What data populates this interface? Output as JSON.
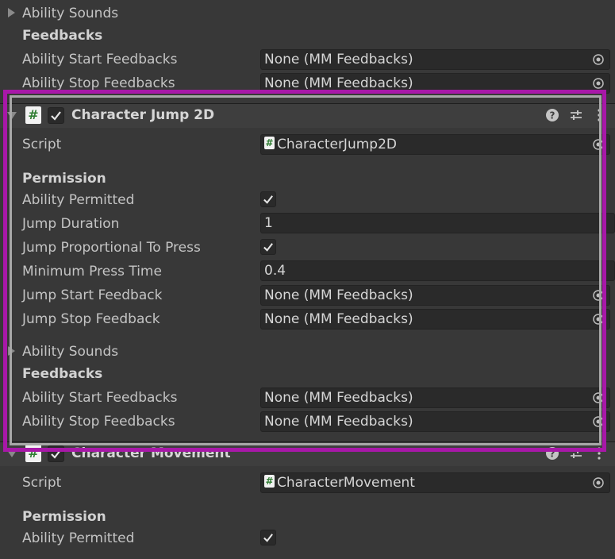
{
  "top_section": {
    "ability_sounds": "Ability Sounds",
    "feedbacks_heading": "Feedbacks",
    "start_label": "Ability Start Feedbacks",
    "start_value": "None (MM Feedbacks)",
    "stop_label": "Ability Stop Feedbacks",
    "stop_value": "None (MM Feedbacks)"
  },
  "jump_component": {
    "title": "Character Jump 2D",
    "script_label": "Script",
    "script_value": "CharacterJump2D",
    "permission_heading": "Permission",
    "ability_permitted_label": "Ability Permitted",
    "ability_permitted": true,
    "jump_duration_label": "Jump Duration",
    "jump_duration_value": "1",
    "jump_proportional_label": "Jump Proportional To Press",
    "jump_proportional": true,
    "min_press_label": "Minimum Press Time",
    "min_press_value": "0.4",
    "jump_start_label": "Jump Start Feedback",
    "jump_start_value": "None (MM Feedbacks)",
    "jump_stop_label": "Jump Stop Feedback",
    "jump_stop_value": "None (MM Feedbacks)",
    "ability_sounds": "Ability Sounds",
    "feedbacks_heading": "Feedbacks",
    "start_label": "Ability Start Feedbacks",
    "start_value": "None (MM Feedbacks)",
    "stop_label": "Ability Stop Feedbacks",
    "stop_value": "None (MM Feedbacks)"
  },
  "movement_component": {
    "title": "Character Movement",
    "script_label": "Script",
    "script_value": "CharacterMovement",
    "permission_heading": "Permission",
    "ability_permitted_label": "Ability Permitted",
    "ability_permitted": true
  },
  "icons": {
    "script": "#",
    "help": "help-icon",
    "presets": "presets-icon",
    "menu": "kebab-menu-icon",
    "object_picker": "object-picker-icon"
  },
  "colors": {
    "highlight_outer": "#a818a8",
    "highlight_inner": "#a8a8a8",
    "background": "#383838"
  }
}
